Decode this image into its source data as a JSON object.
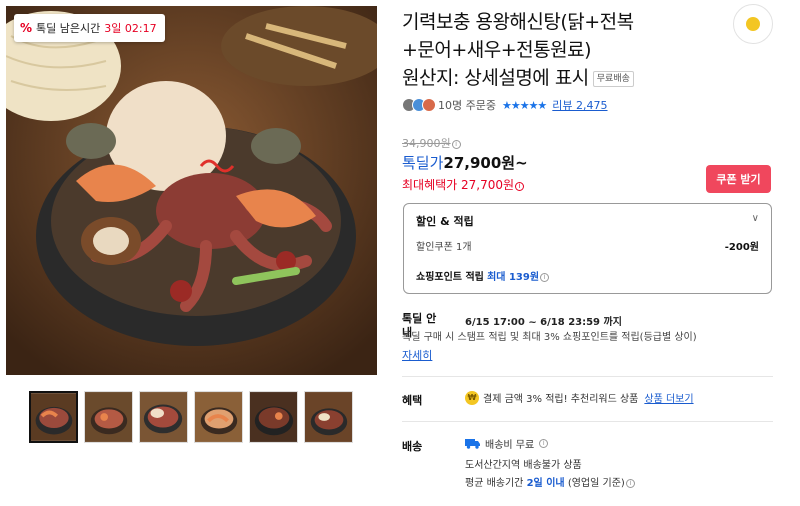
{
  "timer": {
    "icon": "percent-icon",
    "label": "톡딜 남은시간",
    "remaining": "3일 02:17"
  },
  "product": {
    "title_line1": "기력보충 용왕해신탕(닭+전복",
    "title_line2": "+문어+새우+전통원료)",
    "title_line3": "원산지: 상세설명에 표시",
    "free_ship_badge": "무료배송"
  },
  "reviews": {
    "orders": "10명 주문중",
    "stars": "★★★★★",
    "review_link": "리뷰 2,475"
  },
  "price": {
    "original": "34,900원",
    "deal_label": "톡딜가",
    "deal_value": "27,900원~",
    "max_benefit": "최대혜택가 27,700원"
  },
  "coupon_button": "쿠폰 받기",
  "discount": {
    "title": "할인 & 적립",
    "coupon_label": "할인쿠폰 1개",
    "coupon_amount": "-200원",
    "point_label": "쇼핑포인트 적립",
    "point_value": "최대 139원"
  },
  "guide": {
    "label": "톡딜 안내",
    "period": "6/15 17:00 ~ 6/18 23:59 까지",
    "desc": "톡딜 구매 시 스탬프 적립 및 최대 3% 쇼핑포인트를 적립(등급별 상이)",
    "more": "자세히"
  },
  "benefit": {
    "label": "혜택",
    "icon_text": "₩",
    "text": "결제 금액 3% 적립! 추천리워드 상품",
    "link": "상품 더보기"
  },
  "shipping": {
    "label": "배송",
    "fee": "배송비 무료",
    "note": "도서산간지역 배송불가 상품",
    "avg_prefix": "평균 배송기간",
    "avg_days": "2일 이내",
    "avg_suffix": "(영업일 기준)"
  },
  "colors": {
    "accent": "#1a5ccf",
    "sale_red": "#e60023",
    "coupon_pink": "#f0475d"
  }
}
